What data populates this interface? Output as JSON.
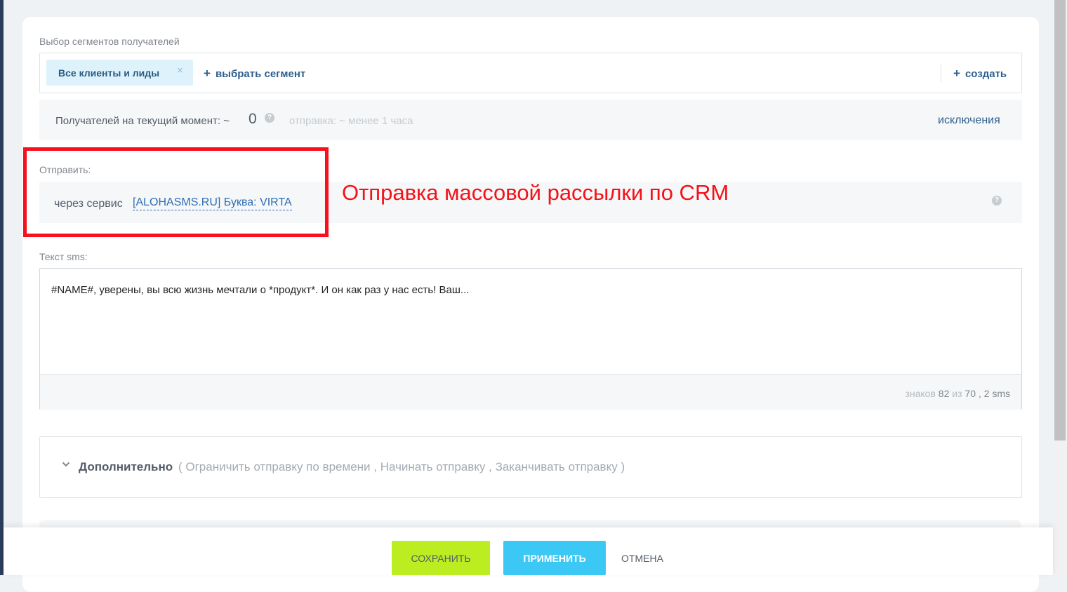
{
  "segments": {
    "label": "Выбор сегментов получателей",
    "chip_label": "Все клиенты и лиды",
    "chip_close": "×",
    "select_label": "выбрать сегмент",
    "create_label": "создать",
    "plus": "+"
  },
  "recipients": {
    "label": "Получателей на текущий момент: ~",
    "count": "0",
    "help": "?",
    "dispatch": "отправка: ~ менее 1 часа",
    "exclusions": "исключения"
  },
  "send": {
    "label": "Отправить:",
    "prefix": "через сервис",
    "service": "[ALOHASMS.RU] Буква: VIRTA",
    "help": "?"
  },
  "annotation": {
    "text": "Отправка массовой рассылки по CRM",
    "color": "#f41118"
  },
  "sms": {
    "label": "Текст sms:",
    "text": "#NAME#, уверены, вы всю жизнь мечтали о *продукт*. И он как раз у нас есть! Ваш...",
    "counter_prefix": "знаков",
    "chars": "82",
    "counter_middle": "из",
    "limit": "70",
    "sms_count": ", 2 sms"
  },
  "additional": {
    "title": "Дополнительно",
    "options": "( Ограничить отправку по времени ,   Начинать отправку ,   Заканчивать отправку   )"
  },
  "footer": {
    "save": "СОХРАНИТЬ",
    "apply": "ПРИМЕНИТЬ",
    "cancel": "ОТМЕНА"
  },
  "colors": {
    "save_button": "#bbed21",
    "apply_button": "#3bc8f5",
    "link": "#2e5f8e",
    "annotation_frame": "#fa0f1c"
  }
}
